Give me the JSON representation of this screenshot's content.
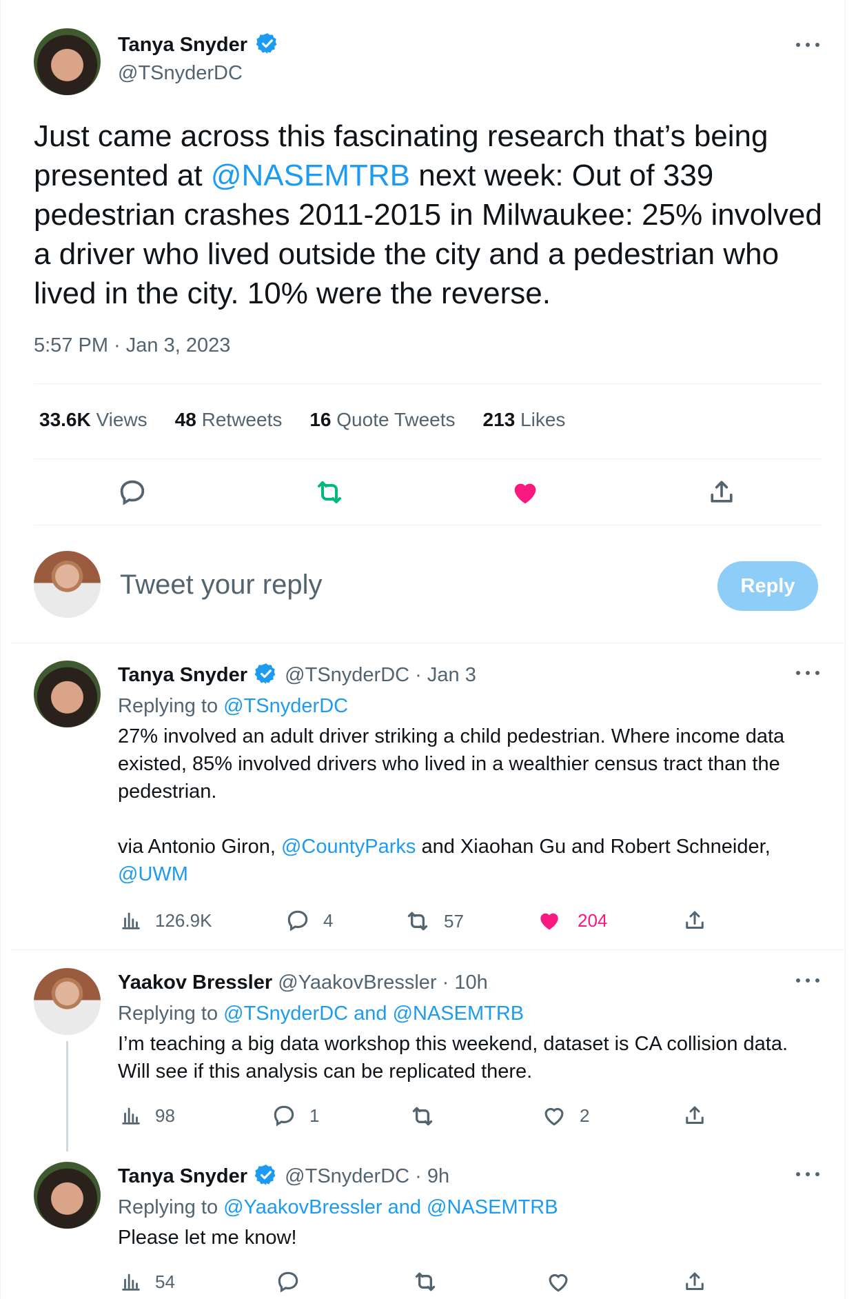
{
  "main_tweet": {
    "author_name": "Tanya Snyder",
    "author_handle": "@TSnyderDC",
    "text_1": "Just came across this fascinating research that’s being presented at ",
    "mention": "@NASEMTRB",
    "text_2": " next week: Out of 339 pedestrian crashes 2011-2015 in Milwaukee: 25% involved a driver who lived outside the city and a pedestrian who lived in the city. 10% were the reverse.",
    "timestamp": "5:57 PM · Jan 3, 2023",
    "stats": {
      "views": "33.6K",
      "views_label": "Views",
      "retweets": "48",
      "retweets_label": "Retweets",
      "quotes": "16",
      "quotes_label": "Quote Tweets",
      "likes": "213",
      "likes_label": "Likes"
    }
  },
  "composer": {
    "placeholder": "Tweet your reply",
    "button_label": "Reply"
  },
  "replies": [
    {
      "author_name": "Tanya Snyder",
      "author_handle": "@TSnyderDC",
      "time": "· Jan 3",
      "replying_label": "Replying to ",
      "replying_to": "@TSnyderDC",
      "paragraph_1": "27% involved an adult driver striking a child pedestrian. Where income data existed, 85% involved drivers who lived in a wealthier census tract than the pedestrian.",
      "p2_a": "via Antonio Giron, ",
      "p2_mention_1": "@CountyParks",
      "p2_b": " and Xiaohan Gu and Robert Schneider, ",
      "p2_mention_2": "@UWM",
      "views": "126.9K",
      "replies": "4",
      "retweets": "57",
      "likes": "204"
    },
    {
      "author_name": "Yaakov Bressler",
      "author_handle": "@YaakovBressler",
      "time": "· 10h",
      "replying_label": "Replying to ",
      "replying_to": "@TSnyderDC and @NASEMTRB",
      "text": "I’m teaching a big data workshop this weekend, dataset is CA collision data. Will see if this analysis can be replicated there.",
      "views": "98",
      "replies": "1",
      "likes": "2"
    },
    {
      "author_name": "Tanya Snyder",
      "author_handle": "@TSnyderDC",
      "time": "· 9h",
      "replying_label": "Replying to ",
      "replying_to": "@YaakovBressler and @NASEMTRB",
      "text": "Please let me know!",
      "views": "54"
    }
  ],
  "colors": {
    "accent": "#1d9bf0",
    "like": "#f91880",
    "retweet": "#00ba7c",
    "muted": "#536471",
    "reply_button_disabled": "#8ecdf8"
  },
  "icons": [
    "verified-badge-icon",
    "more-icon",
    "reply-icon",
    "retweet-icon",
    "like-icon",
    "share-icon",
    "views-icon"
  ]
}
